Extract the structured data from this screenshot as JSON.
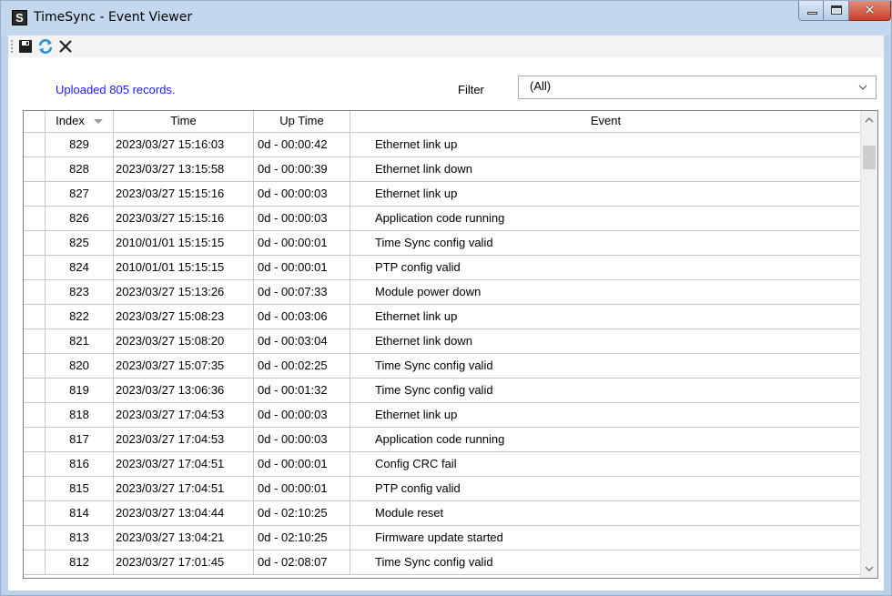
{
  "window": {
    "title": "TimeSync - Event Viewer",
    "app_icon_glyph": "S"
  },
  "toolbar": {
    "icons": [
      "save-icon",
      "refresh-icon",
      "delete-icon"
    ]
  },
  "status": {
    "text": "Uploaded 805 records."
  },
  "filter": {
    "label": "Filter",
    "value": "(All)"
  },
  "grid": {
    "columns": [
      "Index",
      "Time",
      "Up Time",
      "Event"
    ],
    "rows": [
      {
        "index": "829",
        "time": "2023/03/27 15:16:03",
        "uptime": "0d - 00:00:42",
        "event": "Ethernet link up"
      },
      {
        "index": "828",
        "time": "2023/03/27 13:15:58",
        "uptime": "0d - 00:00:39",
        "event": "Ethernet link down"
      },
      {
        "index": "827",
        "time": "2023/03/27 15:15:16",
        "uptime": "0d - 00:00:03",
        "event": "Ethernet link up"
      },
      {
        "index": "826",
        "time": "2023/03/27 15:15:16",
        "uptime": "0d - 00:00:03",
        "event": "Application code running"
      },
      {
        "index": "825",
        "time": "2010/01/01 15:15:15",
        "uptime": "0d - 00:00:01",
        "event": "Time Sync config valid"
      },
      {
        "index": "824",
        "time": "2010/01/01 15:15:15",
        "uptime": "0d - 00:00:01",
        "event": "PTP config valid"
      },
      {
        "index": "823",
        "time": "2023/03/27 15:13:26",
        "uptime": "0d - 00:07:33",
        "event": "Module power down"
      },
      {
        "index": "822",
        "time": "2023/03/27 15:08:23",
        "uptime": "0d - 00:03:06",
        "event": "Ethernet link up"
      },
      {
        "index": "821",
        "time": "2023/03/27 15:08:20",
        "uptime": "0d - 00:03:04",
        "event": "Ethernet link down"
      },
      {
        "index": "820",
        "time": "2023/03/27 15:07:35",
        "uptime": "0d - 00:02:25",
        "event": "Time Sync config valid"
      },
      {
        "index": "819",
        "time": "2023/03/27 13:06:36",
        "uptime": "0d - 00:01:32",
        "event": "Time Sync config valid"
      },
      {
        "index": "818",
        "time": "2023/03/27 17:04:53",
        "uptime": "0d - 00:00:03",
        "event": "Ethernet link up"
      },
      {
        "index": "817",
        "time": "2023/03/27 17:04:53",
        "uptime": "0d - 00:00:03",
        "event": "Application code running"
      },
      {
        "index": "816",
        "time": "2023/03/27 17:04:51",
        "uptime": "0d - 00:00:01",
        "event": "Config CRC fail"
      },
      {
        "index": "815",
        "time": "2023/03/27 17:04:51",
        "uptime": "0d - 00:00:01",
        "event": "PTP config valid"
      },
      {
        "index": "814",
        "time": "2023/03/27 13:04:44",
        "uptime": "0d - 02:10:25",
        "event": "Module reset"
      },
      {
        "index": "813",
        "time": "2023/03/27 13:04:21",
        "uptime": "0d - 02:10:25",
        "event": "Firmware update started"
      },
      {
        "index": "812",
        "time": "2023/03/27 17:01:45",
        "uptime": "0d - 02:08:07",
        "event": "Time Sync config valid"
      }
    ]
  },
  "colors": {
    "status_text": "#1a1aff",
    "titlebar": "#c3d8ef",
    "close_button": "#c8412b"
  }
}
